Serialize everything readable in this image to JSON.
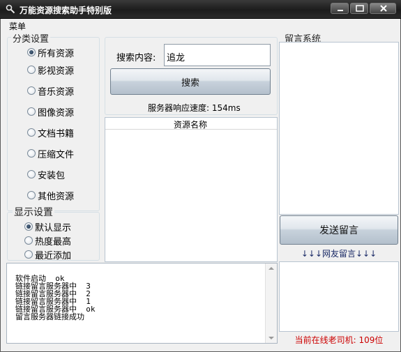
{
  "window": {
    "title": "万能资源搜索助手特别版"
  },
  "menu": {
    "label": "菜单"
  },
  "category": {
    "title": "分类设置",
    "options": [
      "所有资源",
      "影视资源",
      "音乐资源",
      "图像资源",
      "文档书籍",
      "压缩文件",
      "安装包",
      "其他资源"
    ],
    "selected": "所有资源"
  },
  "display": {
    "title": "显示设置",
    "options": [
      "默认显示",
      "热度最高",
      "最近添加"
    ],
    "selected": "默认显示"
  },
  "search": {
    "label": "搜索内容:",
    "value": "追龙",
    "button": "搜索",
    "server_speed": "服务器响应速度: 154ms"
  },
  "results": {
    "column": "资源名称"
  },
  "message": {
    "title": "留言系统",
    "send_button": "发送留言",
    "separator": "↓↓↓网友留言↓↓↓",
    "online": "当前在线老司机: 109位"
  },
  "log": {
    "lines": [
      "软件启动  ok",
      "链接留言服务器中  3",
      "链接留言服务器中  2",
      "链接留言服务器中  1",
      "链接留言服务器中  ok",
      "留言服务器链接成功"
    ]
  },
  "colors": {
    "titlebar": "#1c1c1c",
    "online_text": "#cc0000"
  }
}
